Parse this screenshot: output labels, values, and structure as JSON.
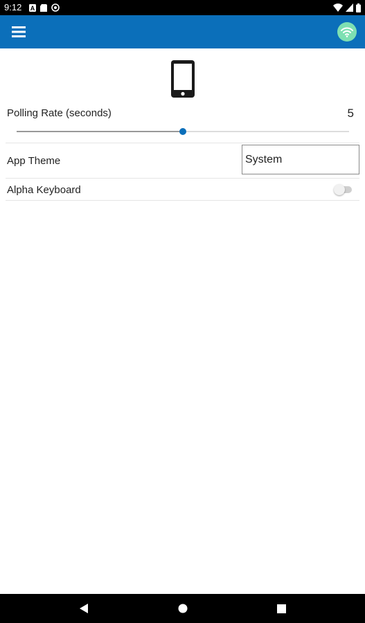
{
  "status_bar": {
    "time": "9:12",
    "left_icons": [
      "notification-a-icon",
      "sim-card-icon",
      "vpn-icon"
    ],
    "right_icons": [
      "wifi-signal-icon",
      "cell-signal-icon",
      "battery-icon"
    ]
  },
  "app_bar": {
    "color": "#0b6fba",
    "menu_icon": "hamburger-menu-icon",
    "connection_icon": "wifi-connected-icon",
    "connection_color": "#7ee0b2"
  },
  "device": {
    "icon": "smartphone-icon"
  },
  "settings": {
    "polling_rate": {
      "label": "Polling Rate (seconds)",
      "value": "5",
      "slider_fraction": 0.5
    },
    "app_theme": {
      "label": "App Theme",
      "selected": "System"
    },
    "alpha_keyboard": {
      "label": "Alpha Keyboard",
      "enabled": false
    }
  },
  "nav_bar": {
    "buttons": [
      "back-icon",
      "home-icon",
      "recents-icon"
    ]
  }
}
